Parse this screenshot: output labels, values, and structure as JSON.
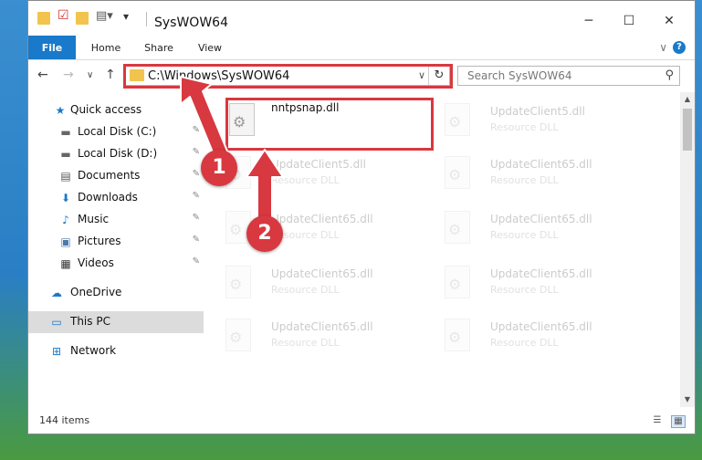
{
  "window": {
    "title": "SysWOW64",
    "minimize_label": "─",
    "maximize_label": "☐",
    "close_label": "✕"
  },
  "ribbon": {
    "tabs": [
      "File",
      "Home",
      "Share",
      "View"
    ],
    "expand_label": "∨",
    "help_label": "?"
  },
  "nav": {
    "back_label": "←",
    "forward_label": "→",
    "recent_label": "∨",
    "up_label": "↑"
  },
  "address": {
    "path": "C:\\Windows\\SysWOW64",
    "chevron_label": "∨",
    "refresh_label": "↻"
  },
  "search": {
    "placeholder": "Search SysWOW64",
    "icon_label": "⚲"
  },
  "sidebar": {
    "items": [
      {
        "label": "Quick access",
        "icon": "star-icon",
        "glyph": "★",
        "pinned": false
      },
      {
        "label": "Local Disk (C:)",
        "icon": "drive-icon",
        "glyph": "▬",
        "pinned": true
      },
      {
        "label": "Local Disk (D:)",
        "icon": "drive-icon",
        "glyph": "▬",
        "pinned": true
      },
      {
        "label": "Documents",
        "icon": "documents-icon",
        "glyph": "▤",
        "pinned": true
      },
      {
        "label": "Downloads",
        "icon": "download-icon",
        "glyph": "⬇",
        "pinned": true
      },
      {
        "label": "Music",
        "icon": "music-icon",
        "glyph": "♪",
        "pinned": true
      },
      {
        "label": "Pictures",
        "icon": "pictures-icon",
        "glyph": "▣",
        "pinned": true
      },
      {
        "label": "Videos",
        "icon": "videos-icon",
        "glyph": "▦",
        "pinned": true
      },
      {
        "label": "OneDrive",
        "icon": "cloud-icon",
        "glyph": "☁",
        "pinned": false
      },
      {
        "label": "This PC",
        "icon": "computer-icon",
        "glyph": "▭",
        "pinned": false
      },
      {
        "label": "Network",
        "icon": "network-icon",
        "glyph": "⊞",
        "pinned": false
      }
    ],
    "pin_glyph": "📌"
  },
  "files": {
    "highlighted": {
      "name": "nntpsnap.dll"
    },
    "faded": [
      {
        "name": "UpdateClient5.dll",
        "type": "Resource DLL"
      },
      {
        "name": "UpdateClient5.dll",
        "type": "Resource DLL"
      },
      {
        "name": "UpdateClient65.dll",
        "type": "Resource DLL"
      },
      {
        "name": "UpdateClient65.dll",
        "type": "Resource DLL"
      },
      {
        "name": "UpdateClient65.dll",
        "type": "Resource DLL"
      },
      {
        "name": "UpdateClient65.dll",
        "type": "Resource DLL"
      },
      {
        "name": "UpdateClient65.dll",
        "type": "Resource DLL"
      },
      {
        "name": "UpdateClient65.dll",
        "type": "Resource DLL"
      },
      {
        "name": "UpdateClient65.dll",
        "type": "Resource DLL"
      }
    ]
  },
  "scrollbar": {
    "up_label": "▲",
    "down_label": "▼"
  },
  "status": {
    "item_count": "144 items",
    "details_view_label": "☰",
    "tiles_view_label": "▦"
  },
  "annotations": {
    "badge_1": "1",
    "badge_2": "2",
    "highlight_color": "#d8383f"
  },
  "colors": {
    "accent": "#1979ca",
    "folder": "#f2c44e"
  }
}
